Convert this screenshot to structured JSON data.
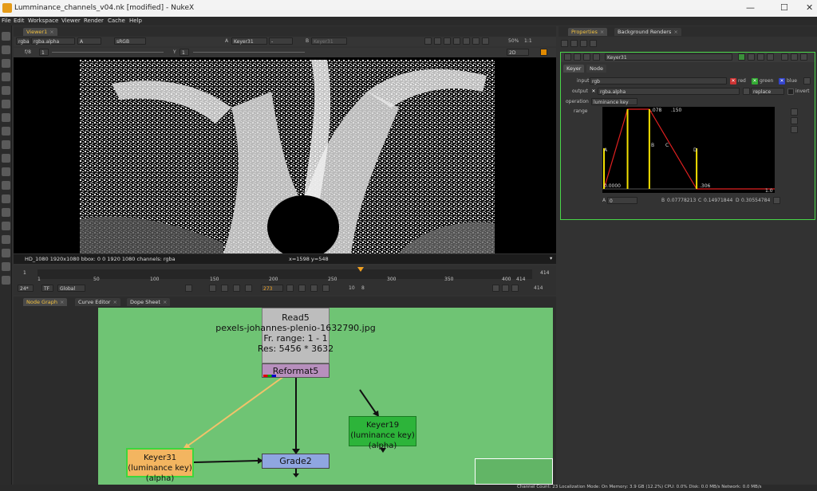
{
  "window": {
    "title": "Lumminance_channels_v04.nk [modified] - NukeX",
    "min": "—",
    "max": "☐",
    "close": "✕"
  },
  "menu": [
    "File",
    "Edit",
    "Workspace",
    "Viewer",
    "Render",
    "Cache",
    "Help"
  ],
  "viewer": {
    "tab": "Viewer1",
    "layer": "rgba",
    "channel": "rgba.alpha",
    "display_channel": "A",
    "colorspace": "sRGB",
    "input_a_label": "A",
    "input_a": "Keyer31",
    "dash": "-",
    "input_b_label": "B",
    "input_b": "Keyer31",
    "zoom": "50%",
    "ratio": "1:1",
    "view_mode": "2D",
    "fstop": "f/8",
    "fstop_val": "1",
    "y_label": "Y",
    "y_val": "1",
    "format": "HD_1080 1920x1080  bbox: 0 0 1920 1080 channels: rgba",
    "coords": "x=1598 y=548"
  },
  "timeline": {
    "ticks": [
      "1",
      "50",
      "100",
      "150",
      "200",
      "250",
      "300",
      "350",
      "400",
      "414"
    ],
    "start": "1",
    "end": "414",
    "current": "273",
    "fps": "24*",
    "tf": "TF",
    "mode": "Global",
    "end_frame": "414",
    "step": "10",
    "inc": "8"
  },
  "graph_tabs": [
    "Node Graph",
    "Curve Editor",
    "Dope Sheet"
  ],
  "nodes": {
    "read": {
      "name": "Read5",
      "file": "pexels-johannes-plenio-1632790.jpg",
      "range": "Fr. range: 1 - 1",
      "res": "Res: 5456 * 3632"
    },
    "reformat": "Reformat5",
    "keyer19": {
      "line1": "Keyer19 (luminance key)",
      "line2": "(alpha)"
    },
    "keyer31": {
      "line1": "Keyer31 (luminance key)",
      "line2": "(alpha)"
    },
    "grade": "Grade2"
  },
  "properties": {
    "tabs": [
      "Properties",
      "Background Renders"
    ],
    "node_name": "Keyer31",
    "subtabs": [
      "Keyer",
      "Node"
    ],
    "input_label": "input",
    "input_value": "rgb",
    "red": "red",
    "green": "green",
    "blue": "blue",
    "output_label": "output",
    "output_value": "rgba.alpha",
    "output_mode": "replace",
    "invert": "invert",
    "operation_label": "operation",
    "operation_value": "luminance key",
    "range_label": "range",
    "graph_labels": {
      "top1": ".078",
      "top2": ".150",
      "A": "A",
      "B": "B",
      "C": "C",
      "D": "D",
      "zero": "0.0000",
      "d_val": ".306",
      "one": "1.0"
    },
    "A_label": "A",
    "A_val": "0",
    "B_label": "B",
    "B_val": "0.07778213",
    "C_label": "C",
    "C_val": "0.14971844",
    "D_label": "D",
    "D_val": "0.30554784"
  },
  "range_curve": {
    "A": 0,
    "B": 0.07778213,
    "C": 0.14971844,
    "D": 0.30554784
  },
  "status": "Channel Count: 23  Localization Mode: On  Memory: 3.9 GB (12.2%)  CPU: 0.0%  Disk: 0.0 MB/s  Network: 0.0 MB/s"
}
